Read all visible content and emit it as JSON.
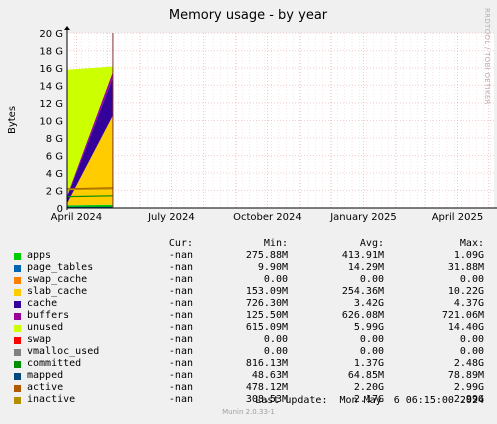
{
  "watermark": "RRDTOOL / TOBI OETIKER",
  "footer": {
    "last_update": "Last update:  Mon May  6 06:15:00 2024",
    "version": "Munin 2.0.33-1"
  },
  "legend_header": {
    "cur": "Cur:",
    "min": "Min:",
    "avg": "Avg:",
    "max": "Max:"
  },
  "legend": [
    {
      "name": "apps",
      "color": "#00cc00",
      "cur": "-nan",
      "min": "275.88M",
      "avg": "413.91M",
      "max": "1.09G"
    },
    {
      "name": "page_tables",
      "color": "#0066b3",
      "cur": "-nan",
      "min": "9.90M",
      "avg": "14.29M",
      "max": "31.88M"
    },
    {
      "name": "swap_cache",
      "color": "#ff8000",
      "cur": "-nan",
      "min": "0.00",
      "avg": "0.00",
      "max": "0.00"
    },
    {
      "name": "slab_cache",
      "color": "#ffcc00",
      "cur": "-nan",
      "min": "153.09M",
      "avg": "254.36M",
      "max": "10.22G"
    },
    {
      "name": "cache",
      "color": "#330099",
      "cur": "-nan",
      "min": "726.30M",
      "avg": "3.42G",
      "max": "4.37G"
    },
    {
      "name": "buffers",
      "color": "#990099",
      "cur": "-nan",
      "min": "125.50M",
      "avg": "626.08M",
      "max": "721.06M"
    },
    {
      "name": "unused",
      "color": "#ccff00",
      "cur": "-nan",
      "min": "615.09M",
      "avg": "5.99G",
      "max": "14.40G"
    },
    {
      "name": "swap",
      "color": "#ff0000",
      "cur": "-nan",
      "min": "0.00",
      "avg": "0.00",
      "max": "0.00"
    },
    {
      "name": "vmalloc_used",
      "color": "#808080",
      "cur": "-nan",
      "min": "0.00",
      "avg": "0.00",
      "max": "0.00"
    },
    {
      "name": "committed",
      "color": "#008f00",
      "cur": "-nan",
      "min": "816.13M",
      "avg": "1.37G",
      "max": "2.48G"
    },
    {
      "name": "mapped",
      "color": "#00487d",
      "cur": "-nan",
      "min": "48.63M",
      "avg": "64.85M",
      "max": "78.89M"
    },
    {
      "name": "active",
      "color": "#b35a00",
      "cur": "-nan",
      "min": "478.12M",
      "avg": "2.20G",
      "max": "2.99G"
    },
    {
      "name": "inactive",
      "color": "#b38f00",
      "cur": "-nan",
      "min": "308.53M",
      "avg": "2.17G",
      "max": "2.99G"
    }
  ],
  "chart_data": {
    "type": "area",
    "title": "Memory usage - by year",
    "ylabel": "Bytes",
    "ylim": [
      0,
      20
    ],
    "y_unit": "G",
    "y_ticks": [
      0,
      2,
      4,
      6,
      8,
      10,
      12,
      14,
      16,
      18,
      20
    ],
    "y_tick_labels": [
      "0",
      "2 G",
      "4 G",
      "6 G",
      "8 G",
      "10 G",
      "12 G",
      "14 G",
      "16 G",
      "18 G",
      "20 G"
    ],
    "x_tick_labels": [
      "April 2024",
      "July 2024",
      "October 2024",
      "January 2025",
      "April 2025"
    ],
    "x_tick_dates": [
      "2024-04-01",
      "2024-07-01",
      "2024-10-01",
      "2025-01-01",
      "2025-04-01"
    ],
    "xlim": [
      "2024-03-23",
      "2025-05-06"
    ],
    "current_time": "2024-05-06",
    "grid": true,
    "stacked_series": [
      {
        "name": "apps",
        "color": "#00cc00",
        "x": [
          "2024-03-23",
          "2024-05-06"
        ],
        "values": [
          0.3,
          0.35
        ]
      },
      {
        "name": "page_tables",
        "color": "#0066b3",
        "x": [
          "2024-03-23",
          "2024-05-06"
        ],
        "values": [
          0.01,
          0.02
        ]
      },
      {
        "name": "slab_cache",
        "color": "#ffcc00",
        "x": [
          "2024-03-23",
          "2024-05-06"
        ],
        "values": [
          0.2,
          10.2
        ]
      },
      {
        "name": "cache",
        "color": "#330099",
        "x": [
          "2024-03-23",
          "2024-05-06"
        ],
        "values": [
          0.75,
          4.3
        ]
      },
      {
        "name": "buffers",
        "color": "#990099",
        "x": [
          "2024-03-23",
          "2024-05-06"
        ],
        "values": [
          0.15,
          0.7
        ]
      },
      {
        "name": "unused",
        "color": "#ccff00",
        "x": [
          "2024-03-23",
          "2024-05-06"
        ],
        "values": [
          14.4,
          0.6
        ]
      }
    ],
    "line_series": [
      {
        "name": "committed",
        "color": "#008f00",
        "x": [
          "2024-03-23",
          "2024-05-06"
        ],
        "values": [
          1.3,
          1.4
        ]
      },
      {
        "name": "mapped",
        "color": "#00487d",
        "x": [
          "2024-03-23",
          "2024-05-06"
        ],
        "values": [
          0.06,
          0.07
        ]
      },
      {
        "name": "active",
        "color": "#b35a00",
        "x": [
          "2024-03-23",
          "2024-05-06"
        ],
        "values": [
          2.2,
          2.3
        ]
      },
      {
        "name": "inactive",
        "color": "#b38f00",
        "x": [
          "2024-03-23",
          "2024-05-06"
        ],
        "values": [
          2.1,
          2.2
        ]
      }
    ]
  }
}
